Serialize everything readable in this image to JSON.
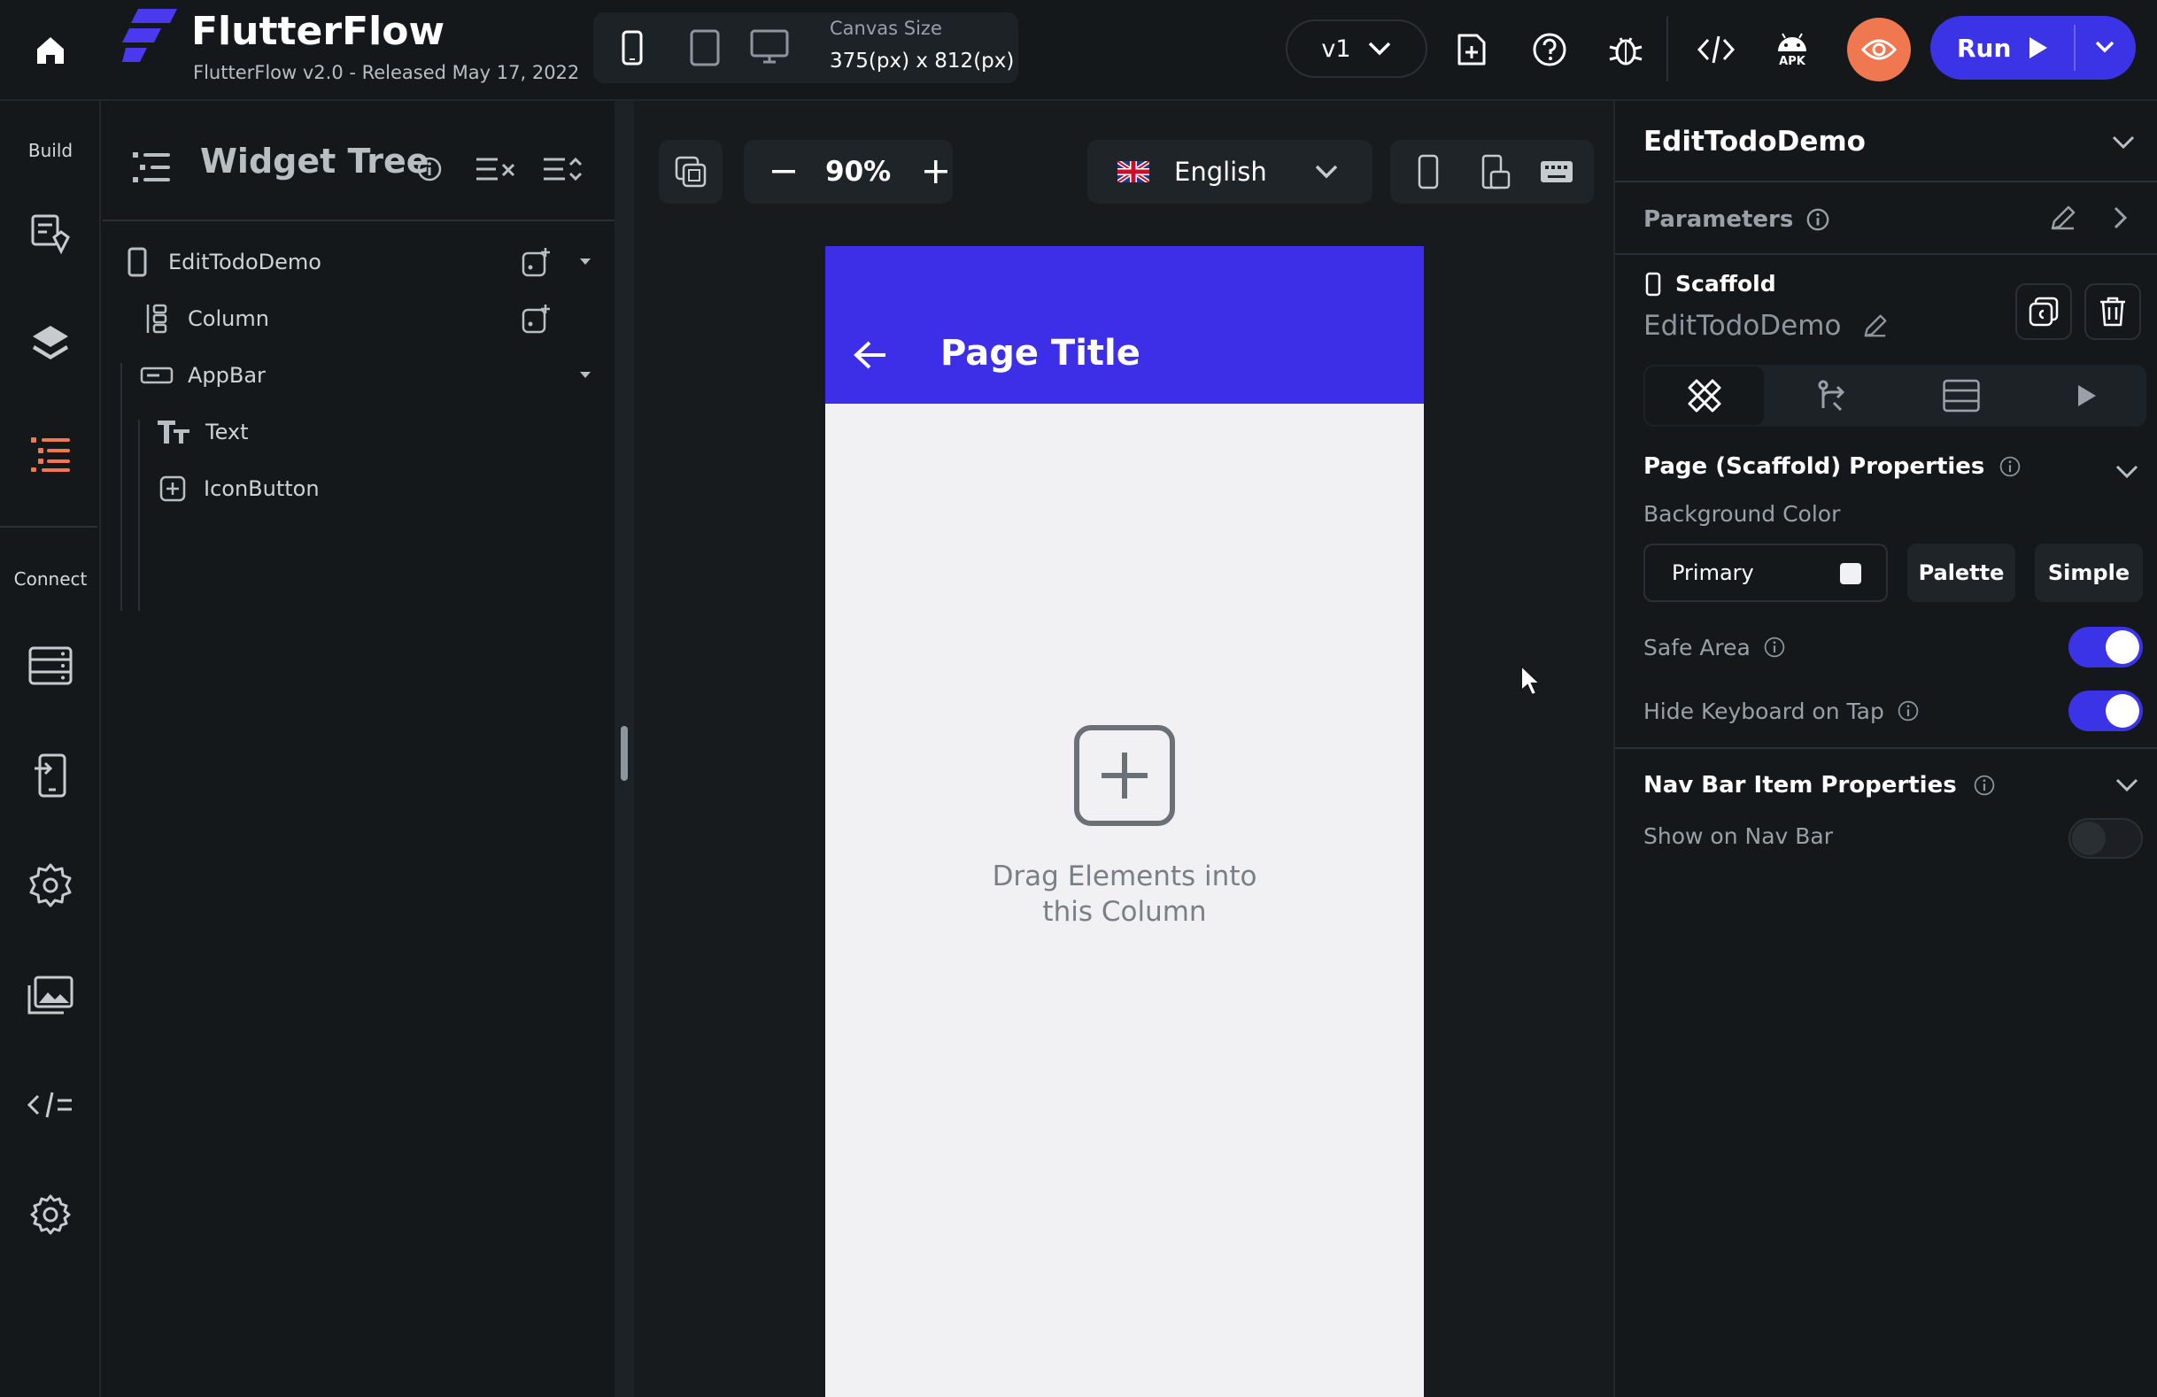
{
  "app": {
    "name": "FlutterFlow",
    "subtitle": "FlutterFlow v2.0 - Released May 17, 2022"
  },
  "toolbar": {
    "canvas_size_label": "Canvas Size",
    "canvas_size_value": "375(px) x 812(px)",
    "version": "v1",
    "run_label": "Run",
    "apk_label": "APK"
  },
  "rail": {
    "build_label": "Build",
    "connect_label": "Connect"
  },
  "widget_tree": {
    "title": "Widget Tree",
    "nodes": [
      {
        "label": "EditTodoDemo",
        "icon": "phone-icon"
      },
      {
        "label": "Column",
        "icon": "column-icon"
      },
      {
        "label": "AppBar",
        "icon": "appbar-icon"
      },
      {
        "label": "Text",
        "icon": "text-icon"
      },
      {
        "label": "IconButton",
        "icon": "add-box-icon"
      }
    ]
  },
  "canvas": {
    "zoom": "90%",
    "language": "English",
    "page_title": "Page Title",
    "drop_hint_line1": "Drag Elements into",
    "drop_hint_line2": "this Column"
  },
  "properties": {
    "page_name": "EditTodoDemo",
    "parameters_label": "Parameters",
    "widget_type": "Scaffold",
    "widget_name": "EditTodoDemo",
    "section_page": "Page (Scaffold) Properties",
    "bg_color_label": "Background Color",
    "bg_color_value": "Primary",
    "palette_label": "Palette",
    "simple_label": "Simple",
    "safe_area_label": "Safe Area",
    "safe_area_on": true,
    "hide_keyboard_label": "Hide Keyboard on Tap",
    "hide_keyboard_on": true,
    "section_nav": "Nav Bar Item Properties",
    "show_nav_label": "Show on Nav Bar",
    "show_nav_on": false
  },
  "colors": {
    "accent": "#3b33e6",
    "preview": "#f07851",
    "appbar": "#3d2ee8",
    "active_rail": "#f07851"
  }
}
